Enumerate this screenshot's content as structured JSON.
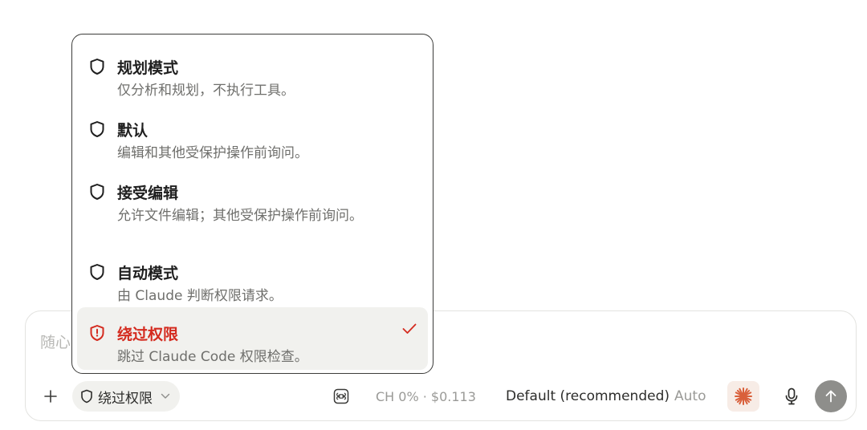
{
  "composer": {
    "placeholder": "随心",
    "mode_chip_label": "绕过权限",
    "usage_text": "CH 0% · $0.113",
    "model_label": "Default (recommended)",
    "model_effort": "Auto"
  },
  "menu": {
    "items": [
      {
        "title": "规划模式",
        "description": "仅分析和规划，不执行工具。"
      },
      {
        "title": "默认",
        "description": "编辑和其他受保护操作前询问。"
      },
      {
        "title": "接受编辑",
        "description": "允许文件编辑；其他受保护操作前询问。"
      },
      {
        "title": "自动模式",
        "description": "由 Claude 判断权限请求。"
      },
      {
        "title": "绕过权限",
        "description": "跳过 Claude Code 权限检查。",
        "selected": true
      }
    ]
  },
  "colors": {
    "danger": "#d42b1f",
    "accent_spark": "#d9603b",
    "send_button": "#8e8e8b"
  },
  "icons": [
    "shield-icon",
    "shield-alert-icon",
    "check-icon",
    "plus-icon",
    "chevron-down-icon",
    "command-key-icon",
    "spark-icon",
    "microphone-icon",
    "arrow-up-icon"
  ]
}
